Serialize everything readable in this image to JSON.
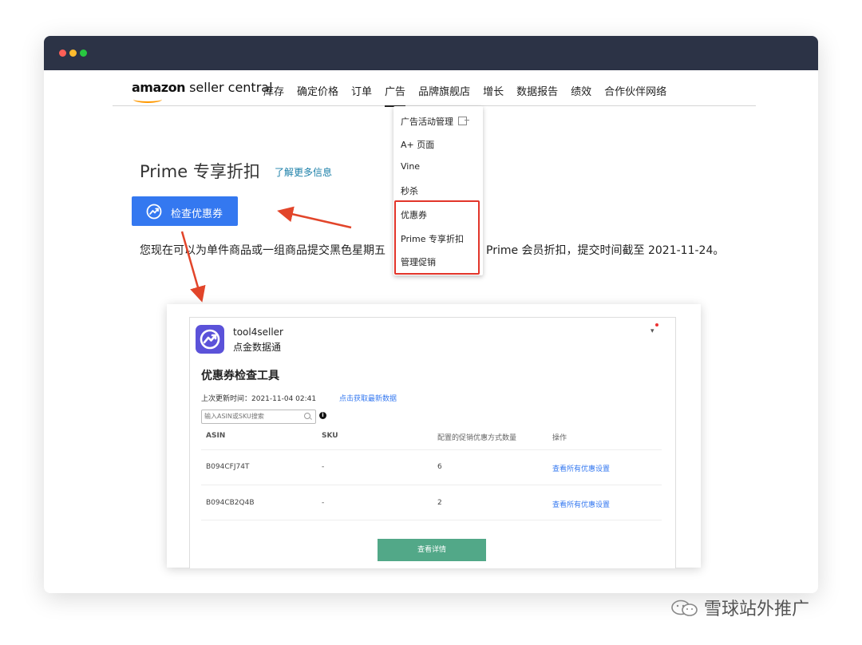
{
  "nav": {
    "logo_amazon": "amazon",
    "logo_product": "seller central",
    "items": [
      "库存",
      "确定价格",
      "订单",
      "广告",
      "品牌旗舰店",
      "增长",
      "数据报告",
      "绩效",
      "合作伙伴网络"
    ],
    "active_item": "广告"
  },
  "dropdown": {
    "items": [
      "广告活动管理",
      "A+ 页面",
      "Vine",
      "秒杀",
      "优惠券",
      "Prime 专享折扣",
      "管理促销"
    ],
    "highlighted": [
      "优惠券",
      "Prime 专享折扣",
      "管理促销"
    ]
  },
  "page": {
    "title": "Prime 专享折扣",
    "learn_more": "了解更多信息",
    "check_button": "检查优惠券",
    "description_left": "您现在可以为单件商品或一组商品提交黑色星期五",
    "description_right": "Prime 会员折扣，提交时间截至 2021-11-24。"
  },
  "extension": {
    "brand_name": "tool4seller",
    "brand_sub": "点金数据通",
    "tool_title": "优惠券检查工具",
    "last_update_label": "上次更新时间：2021-11-04 02:41",
    "fetch_link": "点击获取最新数据",
    "search_placeholder": "输入ASIN或SKU搜索",
    "columns": [
      "ASIN",
      "SKU",
      "配置的促销优惠方式数量",
      "操作"
    ],
    "rows": [
      {
        "asin": "B094CFJ74T",
        "sku": "-",
        "count": "6",
        "action": "查看所有优惠设置"
      },
      {
        "asin": "B094CB2Q4B",
        "sku": "-",
        "count": "2",
        "action": "查看所有优惠设置"
      }
    ],
    "detail_button": "查看详情"
  },
  "watermark": "雪球站外推广",
  "colors": {
    "titlebar": "#2c3346",
    "primary_button": "#3478f0",
    "highlight_box": "#e2352a",
    "detail_button": "#52a888",
    "amazon_orange": "#ff9900"
  }
}
